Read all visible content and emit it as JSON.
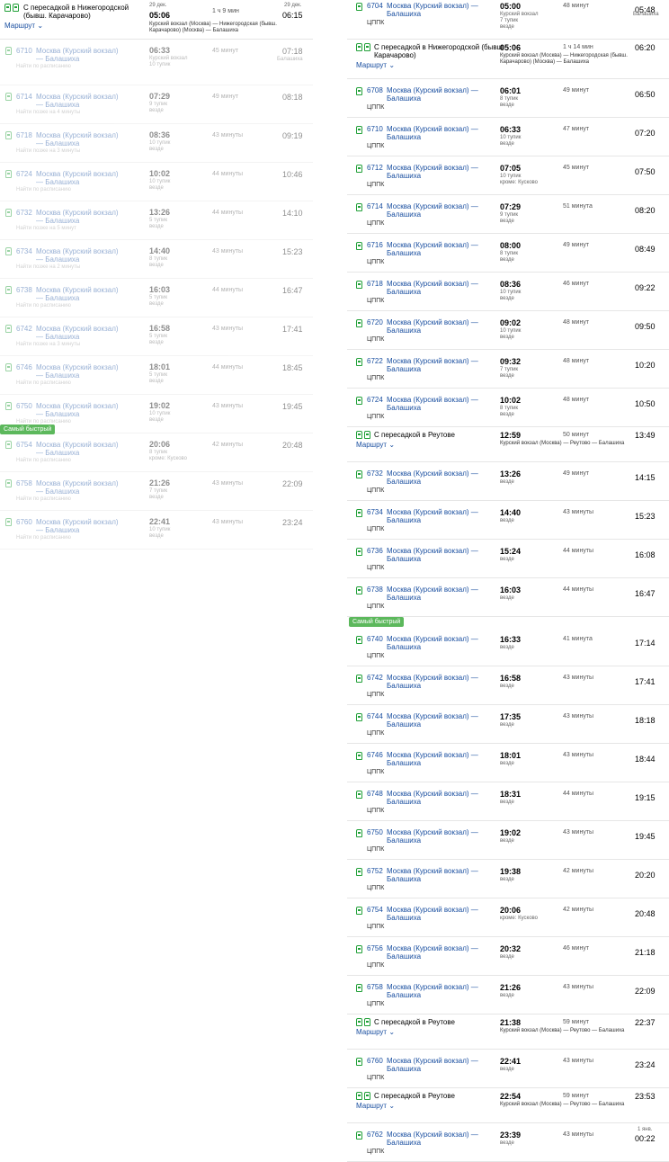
{
  "labels": {
    "route": "Маршрут",
    "title": "Москва (Курский вокзал) — Балашиха",
    "carrier": "ЦППК",
    "fastest": "Самый быстрый",
    "xfer_reutovo": "С пересадкой в Реутове",
    "xfer_nizhegorodskaya": "С пересадкой в Нижегородской (бывш. Карачарово)",
    "path_nizh": "Курский вокзал (Москва) — Нижегородская (бывш. Карачарово) (Москва) — Балашиха",
    "path_reut": "Курский вокзал (Москва) — Реутово — Балашиха"
  },
  "left": {
    "first": {
      "date_dep": "29 дек.",
      "dep": "05:06",
      "dur": "1 ч 9 мин",
      "date_arr": "29 дек.",
      "arr": "06:15"
    },
    "trips": [
      {
        "num": "6710",
        "dep": "06:33",
        "sub": "Курский вокзал",
        "sub2": "10 тупик",
        "dur": "45 минут",
        "arr": "07:18",
        "arrsub": "Балашиха",
        "note": "Найти по расписанию"
      },
      {
        "num": "6714",
        "dep": "07:29",
        "sub": "9 тупик",
        "sub2": "везде",
        "dur": "49 минут",
        "arr": "08:18",
        "arrsub": "",
        "note": "Найти позже на 4 минуты"
      },
      {
        "num": "6718",
        "dep": "08:36",
        "sub": "10 тупик",
        "sub2": "везде",
        "dur": "43 минуты",
        "arr": "09:19",
        "arrsub": "",
        "note": "Найти позже на 3 минуты"
      },
      {
        "num": "6724",
        "dep": "10:02",
        "sub": "10 тупик",
        "sub2": "везде",
        "dur": "44 минуты",
        "arr": "10:46",
        "arrsub": "",
        "note": "Найти по расписанию"
      },
      {
        "num": "6732",
        "dep": "13:26",
        "sub": "5 тупик",
        "sub2": "везде",
        "dur": "44 минуты",
        "arr": "14:10",
        "arrsub": "",
        "note": "Найти позже на 5 минут"
      },
      {
        "num": "6734",
        "dep": "14:40",
        "sub": "8 тупик",
        "sub2": "везде",
        "dur": "43 минуты",
        "arr": "15:23",
        "arrsub": "",
        "note": "Найти позже на 2 минуты"
      },
      {
        "num": "6738",
        "dep": "16:03",
        "sub": "5 тупик",
        "sub2": "везде",
        "dur": "44 минуты",
        "arr": "16:47",
        "arrsub": "",
        "note": "Найти по расписанию"
      },
      {
        "num": "6742",
        "dep": "16:58",
        "sub": "5 тупик",
        "sub2": "везде",
        "dur": "43 минуты",
        "arr": "17:41",
        "arrsub": "",
        "note": "Найти позже на 3 минуты"
      },
      {
        "num": "6746",
        "dep": "18:01",
        "sub": "5 тупик",
        "sub2": "везде",
        "dur": "44 минуты",
        "arr": "18:45",
        "arrsub": "",
        "note": "Найти по расписанию"
      },
      {
        "num": "6750",
        "dep": "19:02",
        "sub": "10 тупик",
        "sub2": "везде",
        "dur": "43 минуты",
        "arr": "19:45",
        "arrsub": "",
        "note": "Найти по расписанию"
      },
      {
        "num": "6754",
        "dep": "20:06",
        "sub": "8 тупик",
        "sub2": "кроме: Кусково",
        "dur": "42 минуты",
        "arr": "20:48",
        "arrsub": "",
        "note": "Найти по расписанию",
        "badge": true
      },
      {
        "num": "6758",
        "dep": "21:26",
        "sub": "7 тупик",
        "sub2": "везде",
        "dur": "43 минуты",
        "arr": "22:09",
        "arrsub": "",
        "note": "Найти по расписанию"
      },
      {
        "num": "6760",
        "dep": "22:41",
        "sub": "10 тупик",
        "sub2": "везде",
        "dur": "43 минуты",
        "arr": "23:24",
        "arrsub": "",
        "note": "Найти по расписанию"
      }
    ]
  },
  "right": {
    "rows": [
      {
        "kind": "train",
        "num": "6704",
        "dep": "05:00",
        "sub": "Курский вокзал",
        "sub2": "7 тупик",
        "sub3": "везде",
        "dur": "48 минут",
        "arr": "05:48",
        "arrsub": "Балашиха"
      },
      {
        "kind": "xfer",
        "title": "xfer_nizhegorodskaya",
        "dep": "05:06",
        "dur": "1 ч 14 мин",
        "arr": "06:20",
        "path": "path_nizh"
      },
      {
        "kind": "train",
        "num": "6708",
        "dep": "06:01",
        "sub": "8 тупик",
        "sub2": "везде",
        "dur": "49 минут",
        "arr": "06:50"
      },
      {
        "kind": "train",
        "num": "6710",
        "dep": "06:33",
        "sub": "10 тупик",
        "sub2": "везде",
        "dur": "47 минут",
        "arr": "07:20"
      },
      {
        "kind": "train",
        "num": "6712",
        "dep": "07:05",
        "sub": "10 тупик",
        "sub2": "кроме: Кусково",
        "dur": "45 минут",
        "arr": "07:50"
      },
      {
        "kind": "train",
        "num": "6714",
        "dep": "07:29",
        "sub": "9 тупик",
        "sub2": "везде",
        "dur": "51 минута",
        "arr": "08:20"
      },
      {
        "kind": "train",
        "num": "6716",
        "dep": "08:00",
        "sub": "8 тупик",
        "sub2": "везде",
        "dur": "49 минут",
        "arr": "08:49"
      },
      {
        "kind": "train",
        "num": "6718",
        "dep": "08:36",
        "sub": "10 тупик",
        "sub2": "везде",
        "dur": "46 минут",
        "arr": "09:22"
      },
      {
        "kind": "train",
        "num": "6720",
        "dep": "09:02",
        "sub": "10 тупик",
        "sub2": "везде",
        "dur": "48 минут",
        "arr": "09:50"
      },
      {
        "kind": "train",
        "num": "6722",
        "dep": "09:32",
        "sub": "7 тупик",
        "sub2": "везде",
        "dur": "48 минут",
        "arr": "10:20"
      },
      {
        "kind": "train",
        "num": "6724",
        "dep": "10:02",
        "sub": "8 тупик",
        "sub2": "везде",
        "dur": "48 минут",
        "arr": "10:50"
      },
      {
        "kind": "xfer",
        "title": "xfer_reutovo",
        "dep": "12:59",
        "dur": "50 минут",
        "arr": "13:49",
        "path": "path_reut"
      },
      {
        "kind": "train",
        "num": "6732",
        "dep": "13:26",
        "sub": "везде",
        "sub2": "",
        "dur": "49 минут",
        "arr": "14:15"
      },
      {
        "kind": "train",
        "num": "6734",
        "dep": "14:40",
        "sub": "везде",
        "sub2": "",
        "dur": "43 минуты",
        "arr": "15:23"
      },
      {
        "kind": "train",
        "num": "6736",
        "dep": "15:24",
        "sub": "везде",
        "sub2": "",
        "dur": "44 минуты",
        "arr": "16:08"
      },
      {
        "kind": "train",
        "num": "6738",
        "dep": "16:03",
        "sub": "везде",
        "sub2": "",
        "dur": "44 минуты",
        "arr": "16:47"
      },
      {
        "kind": "train",
        "num": "6740",
        "dep": "16:33",
        "sub": "везде",
        "sub2": "",
        "dur": "41 минута",
        "arr": "17:14",
        "badge": true
      },
      {
        "kind": "train",
        "num": "6742",
        "dep": "16:58",
        "sub": "везде",
        "sub2": "",
        "dur": "43 минуты",
        "arr": "17:41"
      },
      {
        "kind": "train",
        "num": "6744",
        "dep": "17:35",
        "sub": "везде",
        "sub2": "",
        "dur": "43 минуты",
        "arr": "18:18"
      },
      {
        "kind": "train",
        "num": "6746",
        "dep": "18:01",
        "sub": "везде",
        "sub2": "",
        "dur": "43 минуты",
        "arr": "18:44"
      },
      {
        "kind": "train",
        "num": "6748",
        "dep": "18:31",
        "sub": "везде",
        "sub2": "",
        "dur": "44 минуты",
        "arr": "19:15"
      },
      {
        "kind": "train",
        "num": "6750",
        "dep": "19:02",
        "sub": "везде",
        "sub2": "",
        "dur": "43 минуты",
        "arr": "19:45"
      },
      {
        "kind": "train",
        "num": "6752",
        "dep": "19:38",
        "sub": "везде",
        "sub2": "",
        "dur": "42 минуты",
        "arr": "20:20"
      },
      {
        "kind": "train",
        "num": "6754",
        "dep": "20:06",
        "sub": "кроме: Кусково",
        "sub2": "",
        "dur": "42 минуты",
        "arr": "20:48"
      },
      {
        "kind": "train",
        "num": "6756",
        "dep": "20:32",
        "sub": "везде",
        "sub2": "",
        "dur": "46 минут",
        "arr": "21:18"
      },
      {
        "kind": "train",
        "num": "6758",
        "dep": "21:26",
        "sub": "везде",
        "sub2": "",
        "dur": "43 минуты",
        "arr": "22:09"
      },
      {
        "kind": "xfer",
        "title": "xfer_reutovo",
        "dep": "21:38",
        "dur": "59 минут",
        "arr": "22:37",
        "path": "path_reut"
      },
      {
        "kind": "train",
        "num": "6760",
        "dep": "22:41",
        "sub": "везде",
        "sub2": "",
        "dur": "43 минуты",
        "arr": "23:24"
      },
      {
        "kind": "xfer",
        "title": "xfer_reutovo",
        "dep": "22:54",
        "dur": "59 минут",
        "arr": "23:53",
        "path": "path_reut"
      },
      {
        "kind": "train",
        "num": "6762",
        "dep": "23:39",
        "sub": "везде",
        "sub2": "",
        "dur": "43 минуты",
        "arr": "00:22",
        "arrdate": "1 янв."
      }
    ]
  }
}
